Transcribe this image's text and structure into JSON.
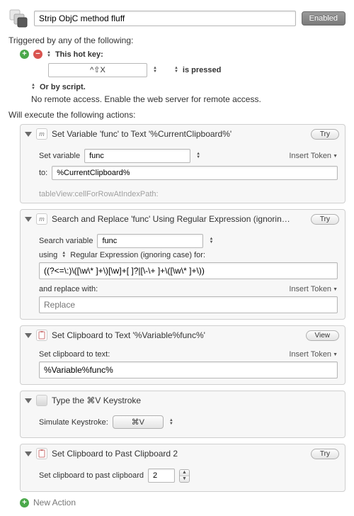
{
  "header": {
    "macro_title": "Strip ObjC method fluff",
    "enabled_button": "Enabled"
  },
  "triggers": {
    "section_label": "Triggered by any of the following:",
    "hotkey_label": "This hot key:",
    "hotkey_value": "^⇧X",
    "hotkey_mode": "is pressed",
    "script_label": "Or by script.",
    "remote_access_note": "No remote access.  Enable the web server for remote access."
  },
  "actions_label": "Will execute the following actions:",
  "ui": {
    "try": "Try",
    "view": "View",
    "insert_token": "Insert Token",
    "new_action": "New Action"
  },
  "action1": {
    "title": "Set Variable 'func' to Text '%CurrentClipboard%'",
    "set_variable_label": "Set variable",
    "variable_name": "func",
    "to_label": "to:",
    "to_value": "%CurrentClipboard%",
    "preview": "tableView:cellForRowAtIndexPath:"
  },
  "action2": {
    "title": "Search and Replace 'func' Using Regular Expression (ignorin…",
    "search_variable_label": "Search variable",
    "variable_name": "func",
    "using_label": "using",
    "using_mode": "Regular Expression (ignoring case) for:",
    "pattern": "((?<=\\:)\\([\\w\\* ]+\\)[\\w]+[ ]?|[\\-\\+ ]+\\([\\w\\* ]+\\))",
    "replace_label": "and replace with:",
    "replace_placeholder": "Replace"
  },
  "action3": {
    "title": "Set Clipboard to Text '%Variable%func%'",
    "row_label": "Set clipboard to text:",
    "value": "%Variable%func%"
  },
  "action4": {
    "title": "Type the ⌘V Keystroke",
    "row_label": "Simulate Keystroke:",
    "key": "⌘V"
  },
  "action5": {
    "title": "Set Clipboard to Past Clipboard 2",
    "row_label": "Set clipboard to past clipboard",
    "value": "2"
  }
}
